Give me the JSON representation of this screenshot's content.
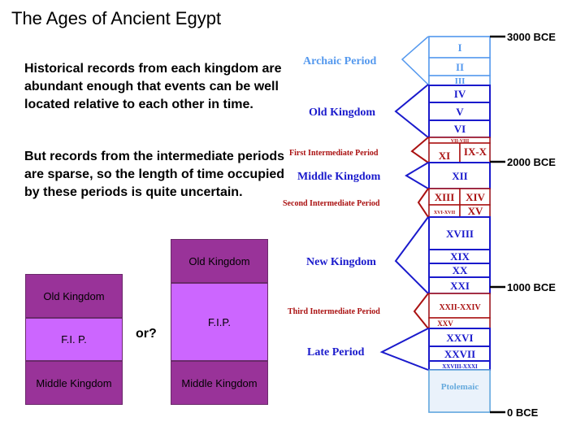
{
  "title": "The Ages of Ancient Egypt",
  "paragraph1": "Historical records from each kingdom  are abundant enough that events can be well located relative to each other in time.",
  "paragraph2": "But records from the intermediate periods are sparse, so the length of time occupied by these periods is quite uncertain.",
  "comparison": {
    "left": {
      "top": "Old Kingdom",
      "middle": "F.I. P.",
      "bottom": "Middle Kingdom"
    },
    "or": "or?",
    "right": {
      "top": "Old Kingdom",
      "middle": "F.I.P.",
      "bottom": "Middle Kingdom"
    }
  },
  "timeline": {
    "dates": [
      "3000 BCE",
      "2000 BCE",
      "1000 BCE",
      "0 BCE"
    ],
    "periods": {
      "archaic": "Archaic Period",
      "old": "Old Kingdom",
      "fip": "First Intermediate Period",
      "middle": "Middle Kingdom",
      "sip": "Second Intermediate Period",
      "new": "New Kingdom",
      "tip": "Third Intermediate Period",
      "late": "Late Period"
    },
    "dynasties": {
      "d1": "I",
      "d2": "II",
      "d3": "III",
      "d4": "IV",
      "d5": "V",
      "d6": "VI",
      "d7_8": "VII-VIII",
      "d9_10": "IX-X",
      "d11": "XI",
      "d12": "XII",
      "d13": "XIII",
      "d14": "XIV",
      "d16_17": "XVI-XVII",
      "d15": "XV",
      "d18": "XVIII",
      "d19": "XIX",
      "d20": "XX",
      "d21": "XXI",
      "d22_24": "XXII-XXIV",
      "d25": "XXV",
      "d26": "XXVI",
      "d27": "XXVII",
      "d28_31": "XXVIII-XXXI",
      "ptolemaic": "Ptolemaic"
    },
    "colors": {
      "archaic": "#5599ee",
      "kingdom": "#1a1acc",
      "intermediate": "#aa1111",
      "ptolemaic": "#66aadd"
    }
  }
}
